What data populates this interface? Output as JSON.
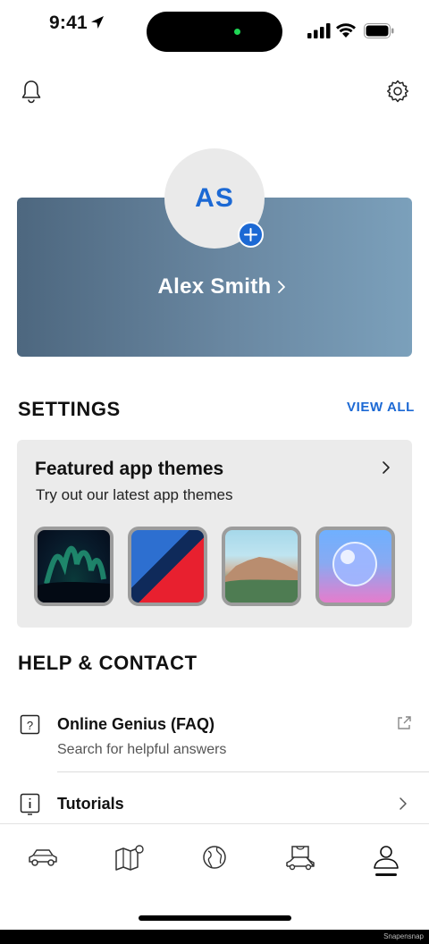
{
  "status_bar": {
    "time": "9:41"
  },
  "profile": {
    "initials": "AS",
    "name": "Alex Smith"
  },
  "settings": {
    "title": "SETTINGS",
    "view_all": "VIEW ALL",
    "featured": {
      "title": "Featured app themes",
      "subtitle": "Try out our latest app themes",
      "themes": [
        {
          "name": "aurora-theme"
        },
        {
          "name": "stripes-theme"
        },
        {
          "name": "mountain-theme"
        },
        {
          "name": "orb-theme"
        }
      ]
    }
  },
  "help": {
    "title": "HELP & CONTACT",
    "items": [
      {
        "title": "Online Genius (FAQ)",
        "subtitle": "Search for helpful answers",
        "icon": "question-icon"
      },
      {
        "title": "Tutorials",
        "icon": "info-icon"
      }
    ]
  },
  "tab_bar": {
    "tabs": [
      {
        "icon": "car-icon"
      },
      {
        "icon": "map-icon"
      },
      {
        "icon": "globe-icon"
      },
      {
        "icon": "shop-icon"
      },
      {
        "icon": "profile-icon",
        "active": true
      }
    ]
  },
  "watermark": "Snapensnap"
}
